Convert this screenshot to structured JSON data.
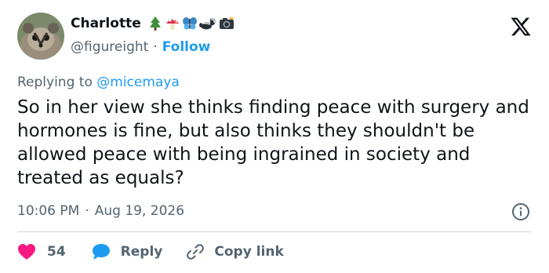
{
  "user": {
    "display_name": "Charlotte",
    "emojis": [
      "tree-emoji",
      "mushroom-emoji",
      "butterfly-emoji",
      "skunk-emoji",
      "camera-emoji"
    ],
    "handle": "@figureight",
    "separator": "·",
    "follow_label": "Follow"
  },
  "reply": {
    "prefix": "Replying to",
    "mention": "@micemaya"
  },
  "tweet": {
    "text": "So in her view she thinks finding peace with surgery and hormones is fine, but also thinks they shouldn't be allowed peace with being ingrained in society and treated as equals?",
    "time": "10:06 PM",
    "separator": "·",
    "date": "Aug 19, 2026"
  },
  "actions": {
    "like_count": "54",
    "reply_label": "Reply",
    "copy_label": "Copy link"
  },
  "colors": {
    "accent": "#1d9bf0",
    "like": "#f91880",
    "muted": "#536471",
    "text": "#0f1419"
  }
}
